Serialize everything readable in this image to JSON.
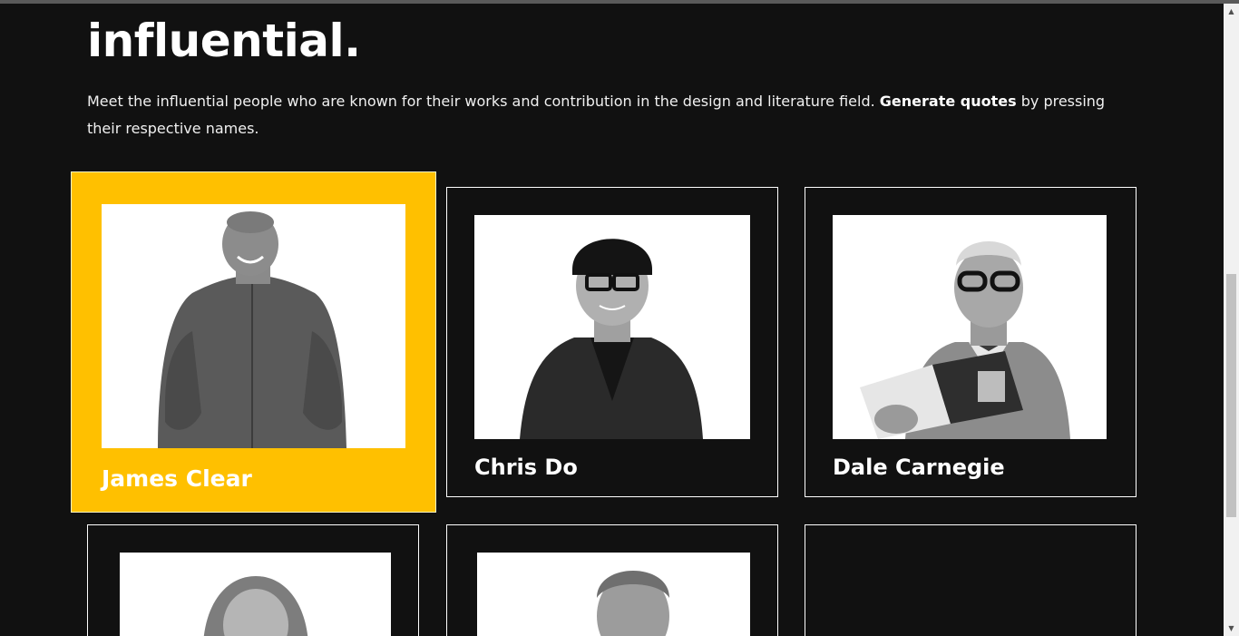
{
  "hero": {
    "headline": "influential.",
    "intro_before": "Meet the influential people who are known for their works and contribution in the design and literature field. ",
    "intro_bold": "Generate quotes",
    "intro_after": " by pressing their respective names."
  },
  "people": [
    {
      "name": "James Clear",
      "active": true
    },
    {
      "name": "Chris Do",
      "active": false
    },
    {
      "name": "Dale Carnegie",
      "active": false
    },
    {
      "name": "",
      "active": false
    },
    {
      "name": "",
      "active": false
    },
    {
      "name": "",
      "active": false
    }
  ],
  "colors": {
    "background": "#111111",
    "accent": "#ffc000",
    "text": "#ffffff"
  },
  "icons": {
    "scroll_up": "triangle-up-icon",
    "scroll_down": "triangle-down-icon"
  }
}
